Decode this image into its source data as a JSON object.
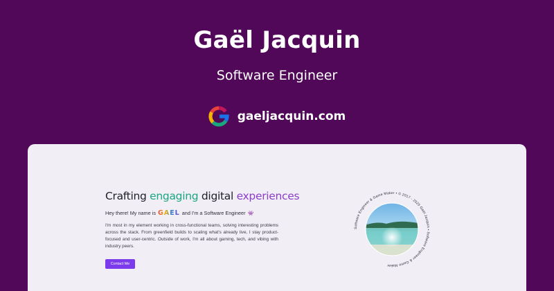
{
  "header": {
    "name": "Gaël Jacquin",
    "role": "Software Engineer",
    "website": "gaeljacquin.com",
    "logo_icon": "g-logo-icon"
  },
  "preview": {
    "hero": {
      "title_prefix": "Crafting ",
      "title_highlight_1": "engaging",
      "title_middle": " digital ",
      "title_highlight_2": "experiences"
    },
    "intro": {
      "before_name": "Hey there! My name is",
      "name_logo": "GAËL",
      "after_name": "and I'm a Software Engineer",
      "emoji": "👾"
    },
    "bio": "I'm most in my element working in cross-functional teams, solving interesting problems across the stack. From greenfield builds to scaling what's already live, I stay product-focused and user-centric. Outside of work, I'm all about gaming, tech, and vibing with industry peers.",
    "contact_button": "Contact Me",
    "badge_ring_text": "Software Engineer & Game Maker • © 2017 - 2025 Gaël Jacquin • ",
    "photo_icon": "beach-photo"
  },
  "colors": {
    "background": "#520859",
    "card": "#f1eef6",
    "accent_button": "#7c3aed",
    "highlight_green": "#1aa77e",
    "highlight_purple": "#8b3ec8"
  }
}
